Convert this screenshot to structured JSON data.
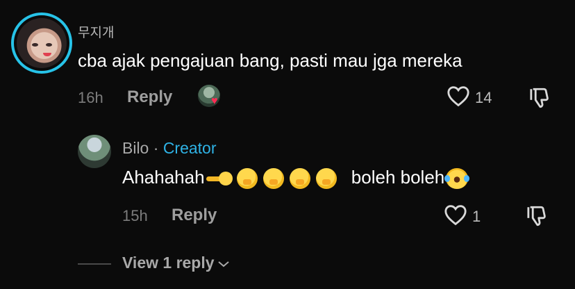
{
  "comment1": {
    "username": "무지개",
    "text": "cba ajak pengajuan bang, pasti mau jga mereka",
    "time": "16h",
    "reply_label": "Reply",
    "likes": "14"
  },
  "comment2": {
    "username": "Bilo",
    "separator": "·",
    "creator_label": "Creator",
    "text_start": "Ahahahah",
    "text_end": "boleh boleh",
    "time": "15h",
    "reply_label": "Reply",
    "likes": "1"
  },
  "view_replies_label": "View 1 reply",
  "colors": {
    "background": "#0b0b0b",
    "accent": "#2fb3e6",
    "story_ring": "#27c3e8",
    "liked_heart": "#ff2d55"
  },
  "icons": [
    "heart-outline-icon",
    "dislike-icon",
    "chevron-down-icon",
    "creator-liked-heart-icon"
  ]
}
